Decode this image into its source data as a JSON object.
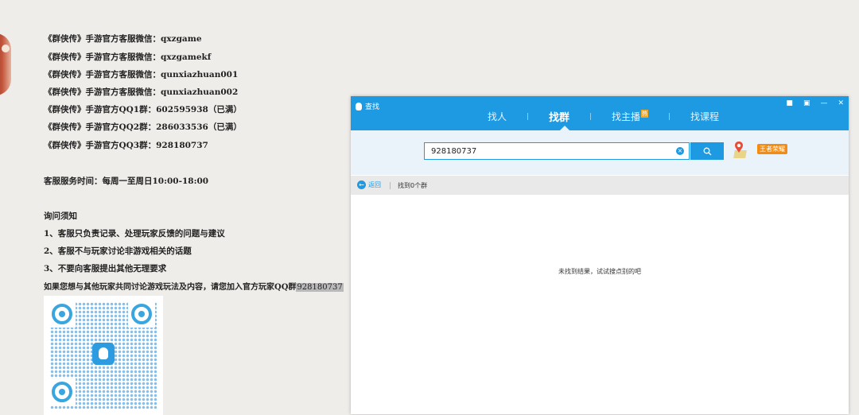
{
  "article": {
    "lines": [
      "《群侠传》手游官方客服微信：qxzgame",
      "《群侠传》手游官方客服微信：qxzgamekf",
      "《群侠传》手游官方客服微信：qunxiazhuan001",
      "《群侠传》手游官方客服微信：qunxiazhuan002",
      "《群侠传》手游官方QQ1群：602595938（已满）",
      "《群侠传》手游官方QQ2群：286033536（已满）",
      "《群侠传》手游官方QQ3群：928180737"
    ],
    "service_hours": "客服服务时间：每周一至周日10:00-18:00",
    "notice_title": "询问须知",
    "notices": [
      "1、客服只负责记录、处理玩家反馈的问题与建议",
      "2、客服不与玩家讨论非游戏相关的话题",
      "3、不要向客服提出其他无理要求"
    ],
    "join_text": "如果您想与其他玩家共同讨论游戏玩法及内容，请您加入官方玩家QQ群",
    "join_number": "928180737"
  },
  "window": {
    "title": "查找",
    "tabs": [
      {
        "label": "找人",
        "active": false
      },
      {
        "label": "找群",
        "active": true
      },
      {
        "label": "找主播",
        "active": false,
        "badge": "热"
      },
      {
        "label": "找课程",
        "active": false
      }
    ],
    "search": {
      "value": "928180737",
      "placeholder": ""
    },
    "game_badge": "王者荣耀",
    "back_label": "返回",
    "result_count": "找到0个群",
    "empty_message": "未找到结果，试试搜点别的吧"
  },
  "colors": {
    "accent": "#1d9ae1",
    "background": "#efedea"
  }
}
